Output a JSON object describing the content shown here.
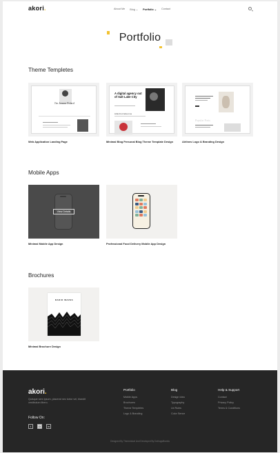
{
  "header": {
    "logo": "akori",
    "logo_dot": ".",
    "menu": [
      "About Me",
      "Blog ⌄",
      "Portfolio ⌄",
      "Contact"
    ],
    "search_icon": "search-icon"
  },
  "hero": {
    "title": "Portfolio"
  },
  "sections": {
    "theme": {
      "title": "Theme Templetes",
      "items": [
        "Web Application Landing Page",
        "Minimal Blog Personal Blog Theme Template Design",
        "Airlines Logo & Branding Design"
      ],
      "mock1_text": "I'm Jeanne Polard",
      "mock2_heading": "A digital agency out of Salt Lake City",
      "mock2_sub": "Little bit of about me",
      "mock3_text": "Popular Posts"
    },
    "mobile": {
      "title": "Mobile Apps",
      "items": [
        "Minimal Mobile App Design",
        "Professional Food Delivery Mobile App Design"
      ],
      "overlay_button": "View Details"
    },
    "brochures": {
      "title": "Brochures",
      "items": [
        "Minimal Brochure Design"
      ],
      "cover_title": "RADIO WAVES"
    }
  },
  "footer": {
    "logo": "akori",
    "logo_dot": ".",
    "description": "Quisque sem ipsum, placerat nec tortor vel, blandit vestibulum libero.",
    "follow": "Follow On:",
    "socials": [
      "twitter-icon",
      "instagram-icon",
      "linkedin-icon"
    ],
    "columns": [
      {
        "title": "Portfolio",
        "links": [
          "Mobile Apps",
          "Brochures",
          "Theme Templetes",
          "Logo & Branding"
        ]
      },
      {
        "title": "Blog",
        "links": [
          "Design Idea",
          "Typography",
          "Ux Rules",
          "Color Sence"
        ]
      },
      {
        "title": "Help & Support",
        "links": [
          "Contact",
          "Privacy Policy",
          "Terms & Conditions"
        ]
      }
    ],
    "credit": "Designed By ThemeAkori And Developed By DothugsBranks"
  },
  "colors": {
    "accent": "#f2c230",
    "footer_bg": "#262626",
    "card_bg": "#f1f1f1"
  }
}
